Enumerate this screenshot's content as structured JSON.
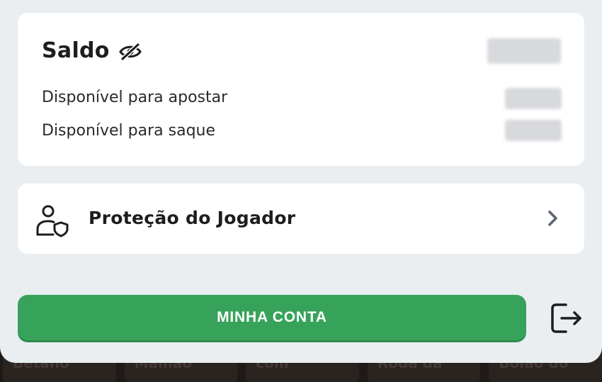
{
  "background": {
    "tiles": [
      "Betano",
      "Mamão",
      "com",
      "Roda da",
      "Bolão do"
    ]
  },
  "balance": {
    "title": "Saldo",
    "visibility_icon": "eye-off-icon",
    "rows": [
      {
        "label": "Disponível para apostar"
      },
      {
        "label": "Disponível para saque"
      }
    ]
  },
  "protection": {
    "label": "Proteção do Jogador",
    "icon": "user-shield-icon",
    "chevron": "chevron-right-icon"
  },
  "account_button": {
    "label": "MINHA CONTA"
  },
  "logout": {
    "icon": "logout-icon"
  },
  "colors": {
    "accent_green": "#37a35a",
    "sheet_bg": "#eaeef1",
    "card_bg": "#ffffff"
  }
}
